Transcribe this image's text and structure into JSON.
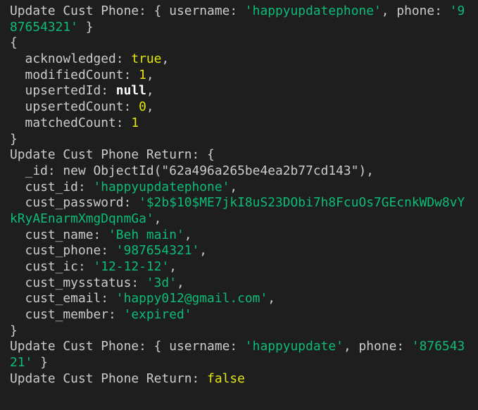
{
  "colors": {
    "background": "#1e1e1e",
    "text": "#cccccc",
    "string": "#0dbc79",
    "number": "#e5e510",
    "null": "#ffffff"
  },
  "terminal": {
    "lines": [
      [
        [
          "t",
          "Update Cust Phone: { username: "
        ],
        [
          "s",
          "'happyupdatephone'"
        ],
        [
          "t",
          ", phone: "
        ],
        [
          "s",
          "'9"
        ]
      ],
      [
        [
          "s",
          "87654321'"
        ],
        [
          "t",
          " }"
        ]
      ],
      [
        [
          "t",
          "{"
        ]
      ],
      [
        [
          "t",
          "  acknowledged: "
        ],
        [
          "b",
          "true"
        ],
        [
          "t",
          ","
        ]
      ],
      [
        [
          "t",
          "  modifiedCount: "
        ],
        [
          "n",
          "1"
        ],
        [
          "t",
          ","
        ]
      ],
      [
        [
          "t",
          "  upsertedId: "
        ],
        [
          "z",
          "null"
        ],
        [
          "t",
          ","
        ]
      ],
      [
        [
          "t",
          "  upsertedCount: "
        ],
        [
          "n",
          "0"
        ],
        [
          "t",
          ","
        ]
      ],
      [
        [
          "t",
          "  matchedCount: "
        ],
        [
          "n",
          "1"
        ]
      ],
      [
        [
          "t",
          "}"
        ]
      ],
      [
        [
          "t",
          "Update Cust Phone Return: {"
        ]
      ],
      [
        [
          "t",
          "  _id: new ObjectId(\"62a496a265be4ea2b77cd143\"),"
        ]
      ],
      [
        [
          "t",
          "  cust_id: "
        ],
        [
          "s",
          "'happyupdatephone'"
        ],
        [
          "t",
          ","
        ]
      ],
      [
        [
          "t",
          "  cust_password: "
        ],
        [
          "s",
          "'$2b$10$ME7jkI8uS23DObi7h8FcuOs7GEcnkWDw8vY"
        ]
      ],
      [
        [
          "s",
          "kRyAEnarmXmgDqnmGa'"
        ],
        [
          "t",
          ","
        ]
      ],
      [
        [
          "t",
          "  cust_name: "
        ],
        [
          "s",
          "'Beh main'"
        ],
        [
          "t",
          ","
        ]
      ],
      [
        [
          "t",
          "  cust_phone: "
        ],
        [
          "s",
          "'987654321'"
        ],
        [
          "t",
          ","
        ]
      ],
      [
        [
          "t",
          "  cust_ic: "
        ],
        [
          "s",
          "'12-12-12'"
        ],
        [
          "t",
          ","
        ]
      ],
      [
        [
          "t",
          "  cust_mysstatus: "
        ],
        [
          "s",
          "'3d'"
        ],
        [
          "t",
          ","
        ]
      ],
      [
        [
          "t",
          "  cust_email: "
        ],
        [
          "s",
          "'happy012@gmail.com'"
        ],
        [
          "t",
          ","
        ]
      ],
      [
        [
          "t",
          "  cust_member: "
        ],
        [
          "s",
          "'expired'"
        ]
      ],
      [
        [
          "t",
          "}"
        ]
      ],
      [
        [
          "t",
          "Update Cust Phone: { username: "
        ],
        [
          "s",
          "'happyupdate'"
        ],
        [
          "t",
          ", phone: "
        ],
        [
          "s",
          "'876543"
        ]
      ],
      [
        [
          "s",
          "21'"
        ],
        [
          "t",
          " }"
        ]
      ],
      [
        [
          "t",
          "Update Cust Phone Return: "
        ],
        [
          "b",
          "false"
        ]
      ]
    ]
  }
}
